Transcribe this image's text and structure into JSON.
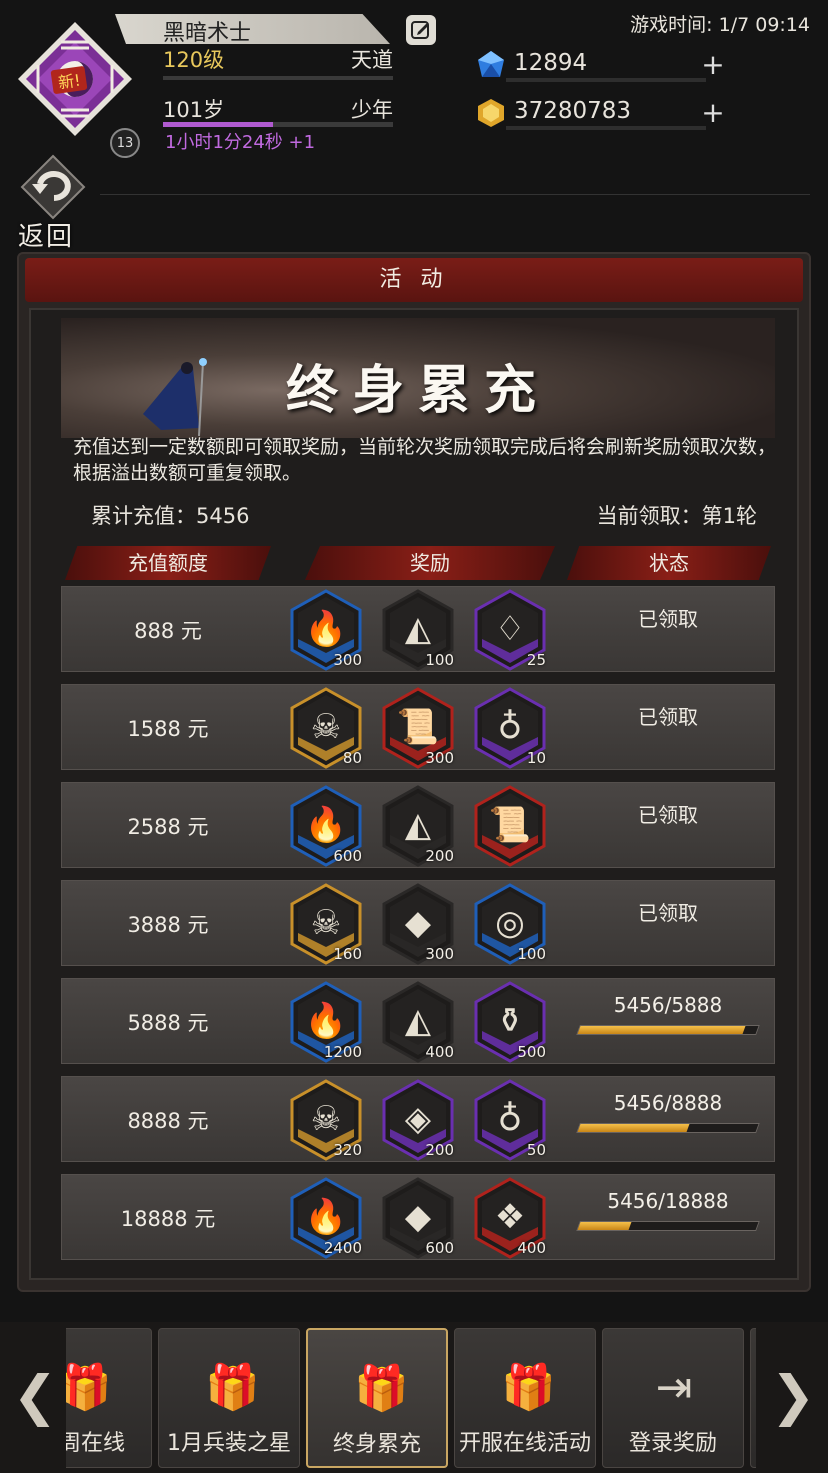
{
  "status": {
    "game_time": "游戏时间: 1/7 09:14"
  },
  "player": {
    "name": "黑暗术士",
    "new_tag": "新!",
    "badge": "13",
    "level": "120级",
    "realm": "天道",
    "age": "101岁",
    "age_stage": "少年",
    "age_progress": 0.48,
    "timer": "1小时1分24秒 +1"
  },
  "currency": {
    "gems": "12894",
    "gold": "37280783",
    "plus": "+"
  },
  "back": {
    "label": "返回"
  },
  "panel": {
    "title": "活 动",
    "banner_title": "终身累充",
    "description": "充值达到一定数额即可领取奖励，当前轮次奖励领取完成后将会刷新奖励领取次数，根据溢出数额可重复领取。",
    "total_recharge": "累计充值：5456",
    "current_round": "当前领取：第1轮",
    "columns": {
      "amount": "充值额度",
      "reward": "奖励",
      "status": "状态"
    },
    "rows": [
      {
        "amount": "888 元",
        "status": "已领取",
        "progress_text": "",
        "progress": null,
        "items": [
          {
            "q": "300",
            "icon": "torch-icon",
            "frame": "blue"
          },
          {
            "q": "100",
            "icon": "fragment-icon",
            "frame": "dark"
          },
          {
            "q": "25",
            "icon": "crystal-icon",
            "frame": "purple"
          }
        ]
      },
      {
        "amount": "1588 元",
        "status": "已领取",
        "progress_text": "",
        "progress": null,
        "items": [
          {
            "q": "80",
            "icon": "skull-icon",
            "frame": "gold"
          },
          {
            "q": "300",
            "icon": "scroll-icon",
            "frame": "red"
          },
          {
            "q": "10",
            "icon": "chalice-icon",
            "frame": "purple"
          }
        ]
      },
      {
        "amount": "2588 元",
        "status": "已领取",
        "progress_text": "",
        "progress": null,
        "items": [
          {
            "q": "600",
            "icon": "torch-icon",
            "frame": "blue"
          },
          {
            "q": "200",
            "icon": "fragment-icon",
            "frame": "dark"
          },
          {
            "q": "",
            "icon": "scroll-plus16-icon",
            "frame": "red"
          }
        ]
      },
      {
        "amount": "3888 元",
        "status": "已领取",
        "progress_text": "",
        "progress": null,
        "items": [
          {
            "q": "160",
            "icon": "skull-icon",
            "frame": "gold"
          },
          {
            "q": "300",
            "icon": "gem-shard-icon",
            "frame": "dark"
          },
          {
            "q": "100",
            "icon": "compass-icon",
            "frame": "blue"
          }
        ]
      },
      {
        "amount": "5888 元",
        "status": "",
        "progress_text": "5456/5888",
        "progress": 0.927,
        "items": [
          {
            "q": "1200",
            "icon": "torch-icon",
            "frame": "blue"
          },
          {
            "q": "400",
            "icon": "fragment-icon",
            "frame": "dark"
          },
          {
            "q": "500",
            "icon": "bottle-icon",
            "frame": "purple"
          }
        ]
      },
      {
        "amount": "8888 元",
        "status": "",
        "progress_text": "5456/8888",
        "progress": 0.614,
        "items": [
          {
            "q": "320",
            "icon": "skull-icon",
            "frame": "gold"
          },
          {
            "q": "200",
            "icon": "diamond-icon",
            "frame": "purple"
          },
          {
            "q": "50",
            "icon": "chalice-icon",
            "frame": "purple"
          }
        ]
      },
      {
        "amount": "18888 元",
        "status": "",
        "progress_text": "5456/18888",
        "progress": 0.289,
        "items": [
          {
            "q": "2400",
            "icon": "torch-icon",
            "frame": "blue"
          },
          {
            "q": "600",
            "icon": "gem-shard-icon",
            "frame": "dark"
          },
          {
            "q": "400",
            "icon": "rune-stone-icon",
            "frame": "red"
          }
        ]
      }
    ]
  },
  "tabs": [
    {
      "label": "每周在线",
      "icon": "gift-icon",
      "active": false
    },
    {
      "label": "1月兵装之星",
      "icon": "gift-icon",
      "active": false
    },
    {
      "label": "终身累充",
      "icon": "gift-icon",
      "active": true
    },
    {
      "label": "开服在线活动",
      "icon": "gift-icon",
      "active": false
    },
    {
      "label": "登录奖励",
      "icon": "login-icon",
      "active": false
    },
    {
      "label": "",
      "icon": "",
      "active": false
    }
  ],
  "nav": {
    "prev": "❮",
    "next": "❯"
  },
  "colors": {
    "frame_blue": "#1f5fb8",
    "frame_purple": "#6a2fb0",
    "frame_gold": "#c8902a",
    "frame_red": "#b0221c",
    "frame_dark": "#2a2827",
    "progress_fill": "#e9a630",
    "header_red": "#7a1d17"
  }
}
